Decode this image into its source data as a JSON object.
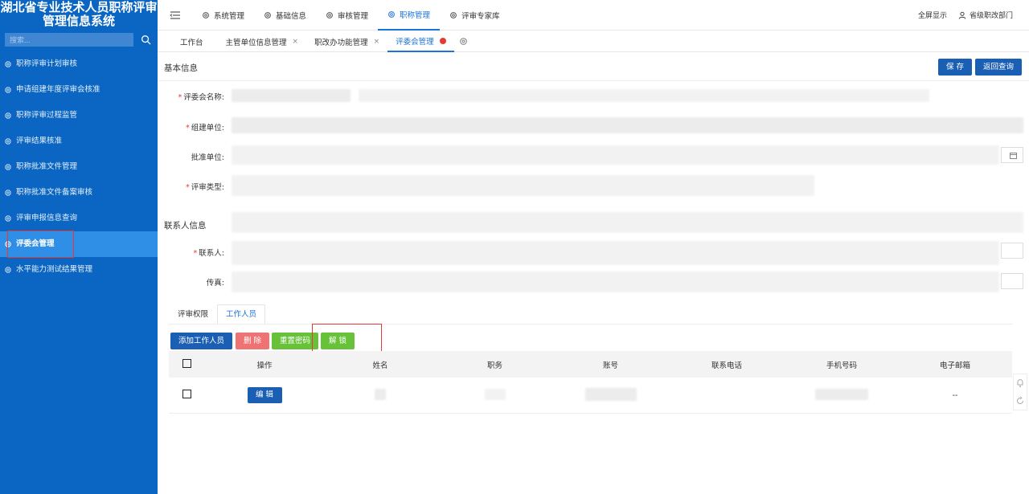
{
  "sidebar": {
    "title": "湖北省专业技术人员职称评审管理信息系统",
    "search_placeholder": "搜索...",
    "items": [
      {
        "label": "职称评审计划审核"
      },
      {
        "label": "申请组建年度评审会核准"
      },
      {
        "label": "职称评审过程监管"
      },
      {
        "label": "评审结果核准"
      },
      {
        "label": "职称批准文件管理"
      },
      {
        "label": "职称批准文件备案审核"
      },
      {
        "label": "评审申报信息查询"
      },
      {
        "label": "评委会管理",
        "active": true
      },
      {
        "label": "水平能力测试结果管理"
      }
    ]
  },
  "topbar": {
    "menus": [
      {
        "label": "系统管理",
        "icon": "gear-icon"
      },
      {
        "label": "基础信息",
        "icon": "gear-icon"
      },
      {
        "label": "审核管理",
        "icon": "gear-icon"
      },
      {
        "label": "职称管理",
        "icon": "gear-icon",
        "active": true
      },
      {
        "label": "评审专家库",
        "icon": "gear-icon"
      }
    ],
    "fullscreen": "全屏显示",
    "user": "省级职改部门"
  },
  "tabs": [
    {
      "label": "工作台"
    },
    {
      "label": "主管单位信息管理",
      "close": "×"
    },
    {
      "label": "职改办功能管理",
      "close": "×"
    },
    {
      "label": "评委会管理",
      "active": true
    }
  ],
  "main": {
    "basic_info_title": "基本信息",
    "save_label": "保 存",
    "back_label": "返回查询",
    "labels": {
      "committee_name": "评委会名称:",
      "org_unit": "组建单位:",
      "approve_unit": "批准单位:",
      "review_type": "评审类型:",
      "contact_person": "联系人:",
      "fax": "传真:"
    },
    "contact_title": "联系人信息",
    "subtabs": [
      "评审权限",
      "工作人员"
    ],
    "actions": {
      "add": "添加工作人员",
      "delete": "删 除",
      "reset": "重置密码",
      "unlock": "解 锁"
    },
    "table": {
      "headers": [
        "操作",
        "姓名",
        "职务",
        "账号",
        "联系电话",
        "手机号码",
        "电子邮箱"
      ],
      "rows": [
        {
          "action": "编 辑",
          "email": "--"
        }
      ]
    }
  },
  "colors": {
    "sidebar_bg": "#0a66c2",
    "active_item": "#2f8ee6",
    "primary_btn": "#1a5fb4",
    "danger_btn": "#f07373",
    "success_btn": "#67c23a",
    "highlight": "#e53935"
  }
}
